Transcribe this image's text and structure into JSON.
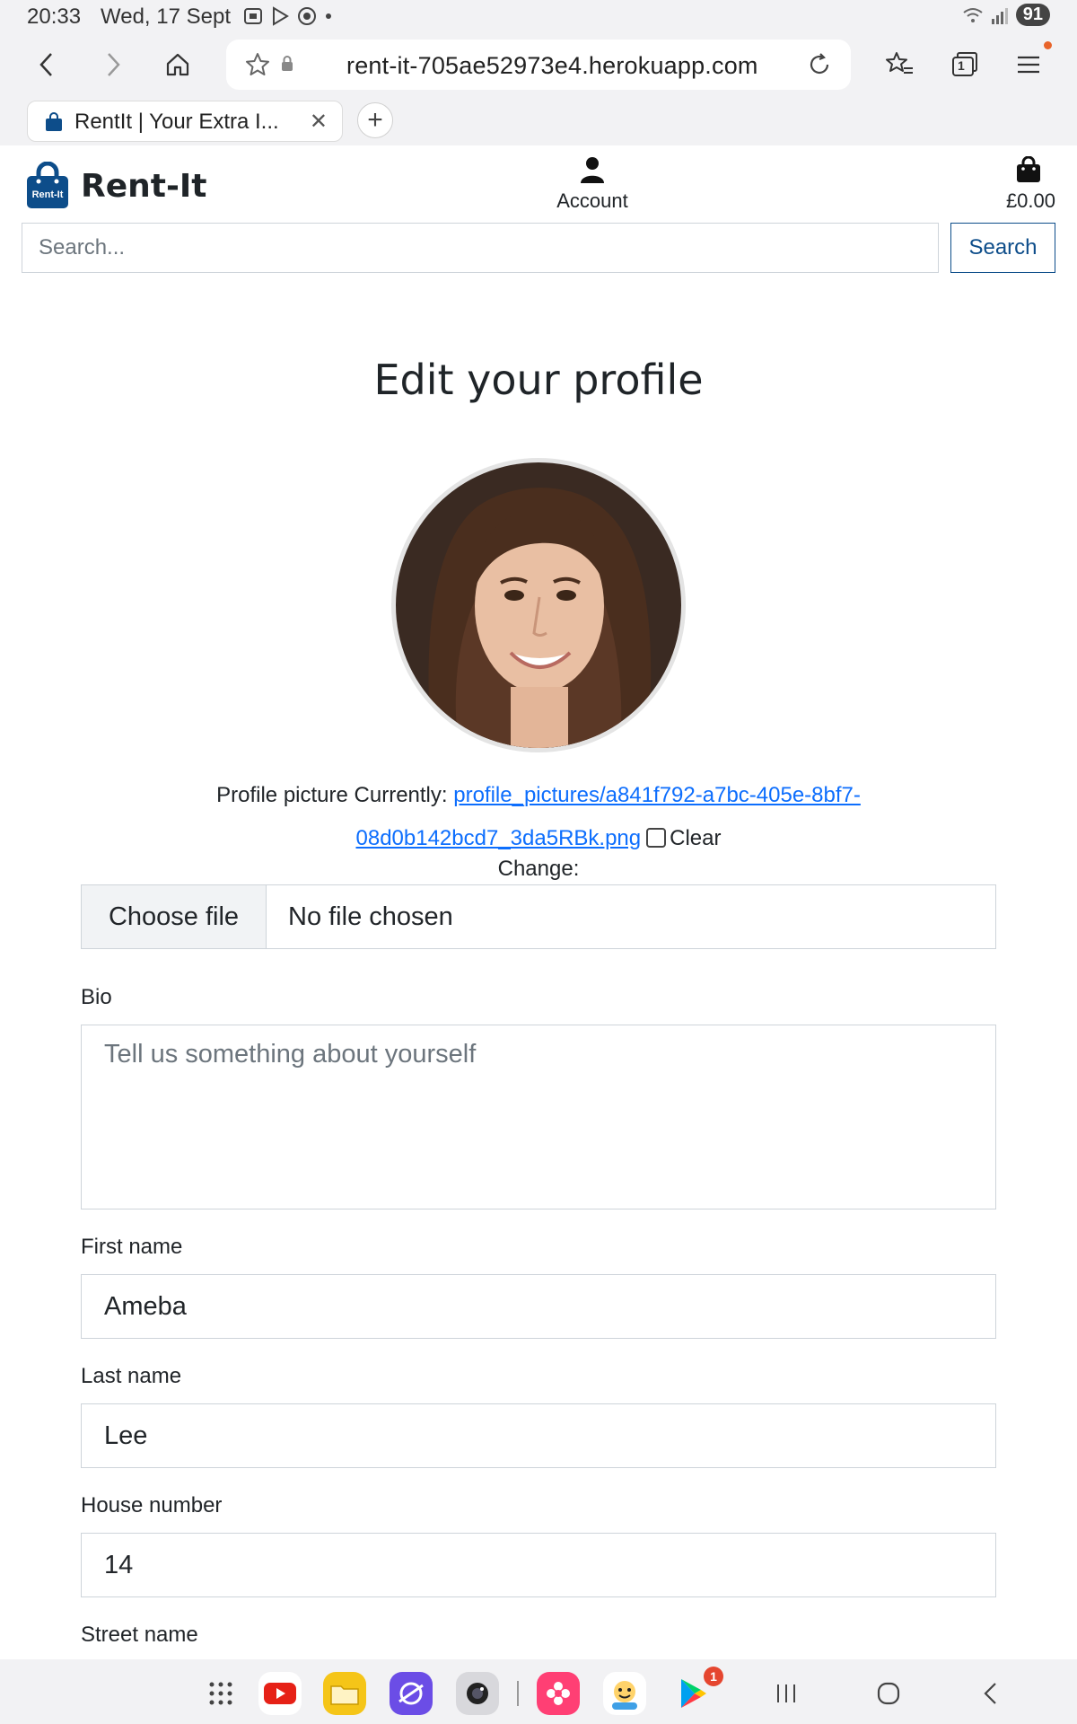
{
  "status_bar": {
    "time": "20:33",
    "date": "Wed, 17 Sept",
    "battery": "91"
  },
  "browser": {
    "url": "rent-it-705ae52973e4.herokuapp.com",
    "tab_title": "RentIt | Your Extra I...",
    "tab_count": "1",
    "accent_dot_color": "#e8642a"
  },
  "site": {
    "brand_name": "Rent-It",
    "logo_text": "Rent-It",
    "account_label": "Account",
    "cart_total": "£0.00",
    "search_placeholder": "Search...",
    "search_button": "Search",
    "brand_color": "#0d4d8a"
  },
  "profile_form": {
    "title": "Edit your profile",
    "picture_label": "Profile picture Currently:",
    "picture_link": "profile_pictures/a841f792-a7bc-405e-8bf7-08d0b142bcd7_3da5RBk.png",
    "clear_label": "Clear",
    "clear_checked": false,
    "change_label": "Change:",
    "file_button": "Choose file",
    "file_status": "No file chosen",
    "bio_label": "Bio",
    "bio_placeholder": "Tell us something about yourself",
    "first_name_label": "First name",
    "first_name_value": "Ameba",
    "last_name_label": "Last name",
    "last_name_value": "Lee",
    "house_number_label": "House number",
    "house_number_value": "14",
    "street_name_label": "Street name"
  },
  "android_nav": {
    "play_badge": "1"
  }
}
